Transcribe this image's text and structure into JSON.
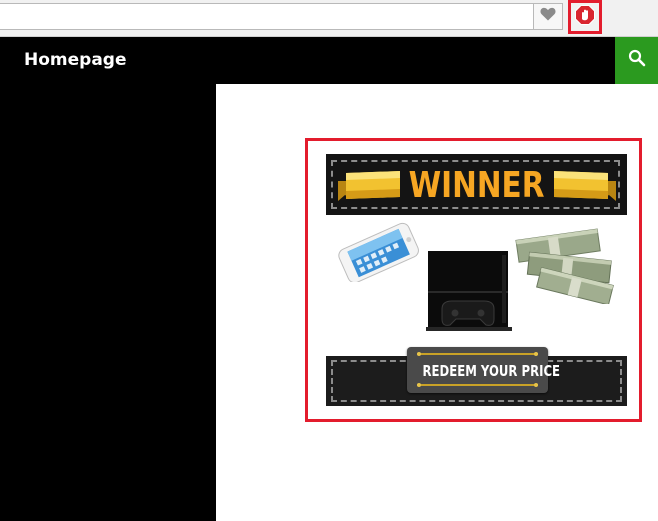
{
  "browser": {
    "bookmark_icon": "heart-icon",
    "adblock_icon": "adblock-stop-hand-icon",
    "highlight_color": "#e31c2d"
  },
  "site": {
    "title": "Homepage",
    "search_icon": "search-icon",
    "search_button_color": "#2b9a1f"
  },
  "ad": {
    "headline": "WINNER",
    "cta_label": "REDEEM YOUR PRICE",
    "prize_icons": [
      "smartphone-image",
      "game-console-image",
      "cash-stacks-image"
    ],
    "headline_color": "#f6a623"
  }
}
